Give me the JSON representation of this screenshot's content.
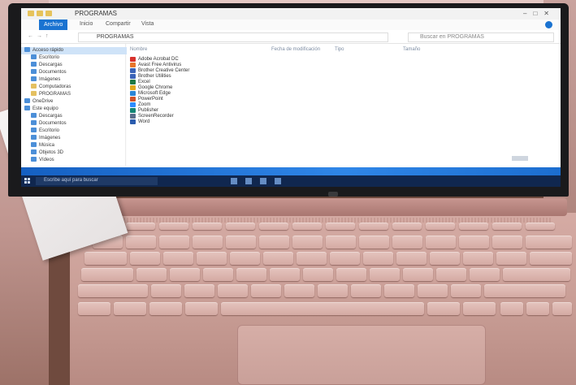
{
  "explorer": {
    "window_title": "PROGRAMAS",
    "ribbon_tabs": [
      "Archivo",
      "Inicio",
      "Compartir",
      "Vista"
    ],
    "address_path": "PROGRAMAS",
    "search_placeholder": "Buscar en PROGRAMAS",
    "columns": {
      "name": "Nombre",
      "date": "Fecha de modificación",
      "type": "Tipo",
      "size": "Tamaño"
    },
    "files": [
      {
        "name": "Adobe Acrobat DC",
        "color": "#d8322c"
      },
      {
        "name": "Avast Free Antivirus",
        "color": "#e8762b"
      },
      {
        "name": "Brother Creative Center",
        "color": "#3a63b8"
      },
      {
        "name": "Brother Utilities",
        "color": "#3a63b8"
      },
      {
        "name": "Excel",
        "color": "#1e7a45"
      },
      {
        "name": "Google Chrome",
        "color": "#e0a81c"
      },
      {
        "name": "Microsoft Edge",
        "color": "#2c86d6"
      },
      {
        "name": "PowerPoint",
        "color": "#d0532a"
      },
      {
        "name": "Zoom",
        "color": "#2d8cff"
      },
      {
        "name": "Publisher",
        "color": "#138574"
      },
      {
        "name": "ScreenRecorder",
        "color": "#5a6d8a"
      },
      {
        "name": "Word",
        "color": "#2b5cae"
      }
    ],
    "nav_items": [
      {
        "label": "Acceso rápido",
        "folder": false,
        "selected": true
      },
      {
        "label": "Escritorio",
        "folder": false,
        "selected": false
      },
      {
        "label": "Descargas",
        "folder": false,
        "selected": false
      },
      {
        "label": "Documentos",
        "folder": false,
        "selected": false
      },
      {
        "label": "Imágenes",
        "folder": false,
        "selected": false
      },
      {
        "label": "Computadoras",
        "folder": true,
        "selected": false
      },
      {
        "label": "PROGRAMAS",
        "folder": true,
        "selected": false
      },
      {
        "label": "OneDrive",
        "folder": false,
        "selected": false
      },
      {
        "label": "Este equipo",
        "folder": false,
        "selected": false
      },
      {
        "label": "Descargas",
        "folder": false,
        "selected": false
      },
      {
        "label": "Documentos",
        "folder": false,
        "selected": false
      },
      {
        "label": "Escritorio",
        "folder": false,
        "selected": false
      },
      {
        "label": "Imágenes",
        "folder": false,
        "selected": false
      },
      {
        "label": "Música",
        "folder": false,
        "selected": false
      },
      {
        "label": "Objetos 3D",
        "folder": false,
        "selected": false
      },
      {
        "label": "Vídeos",
        "folder": false,
        "selected": false
      }
    ]
  },
  "taskbar": {
    "search_placeholder": "Escribe aquí para buscar"
  },
  "colors": {
    "accent": "#1a73d1",
    "wallpaper": "#1b6ccf",
    "laptop_body": "#cfa39c"
  }
}
